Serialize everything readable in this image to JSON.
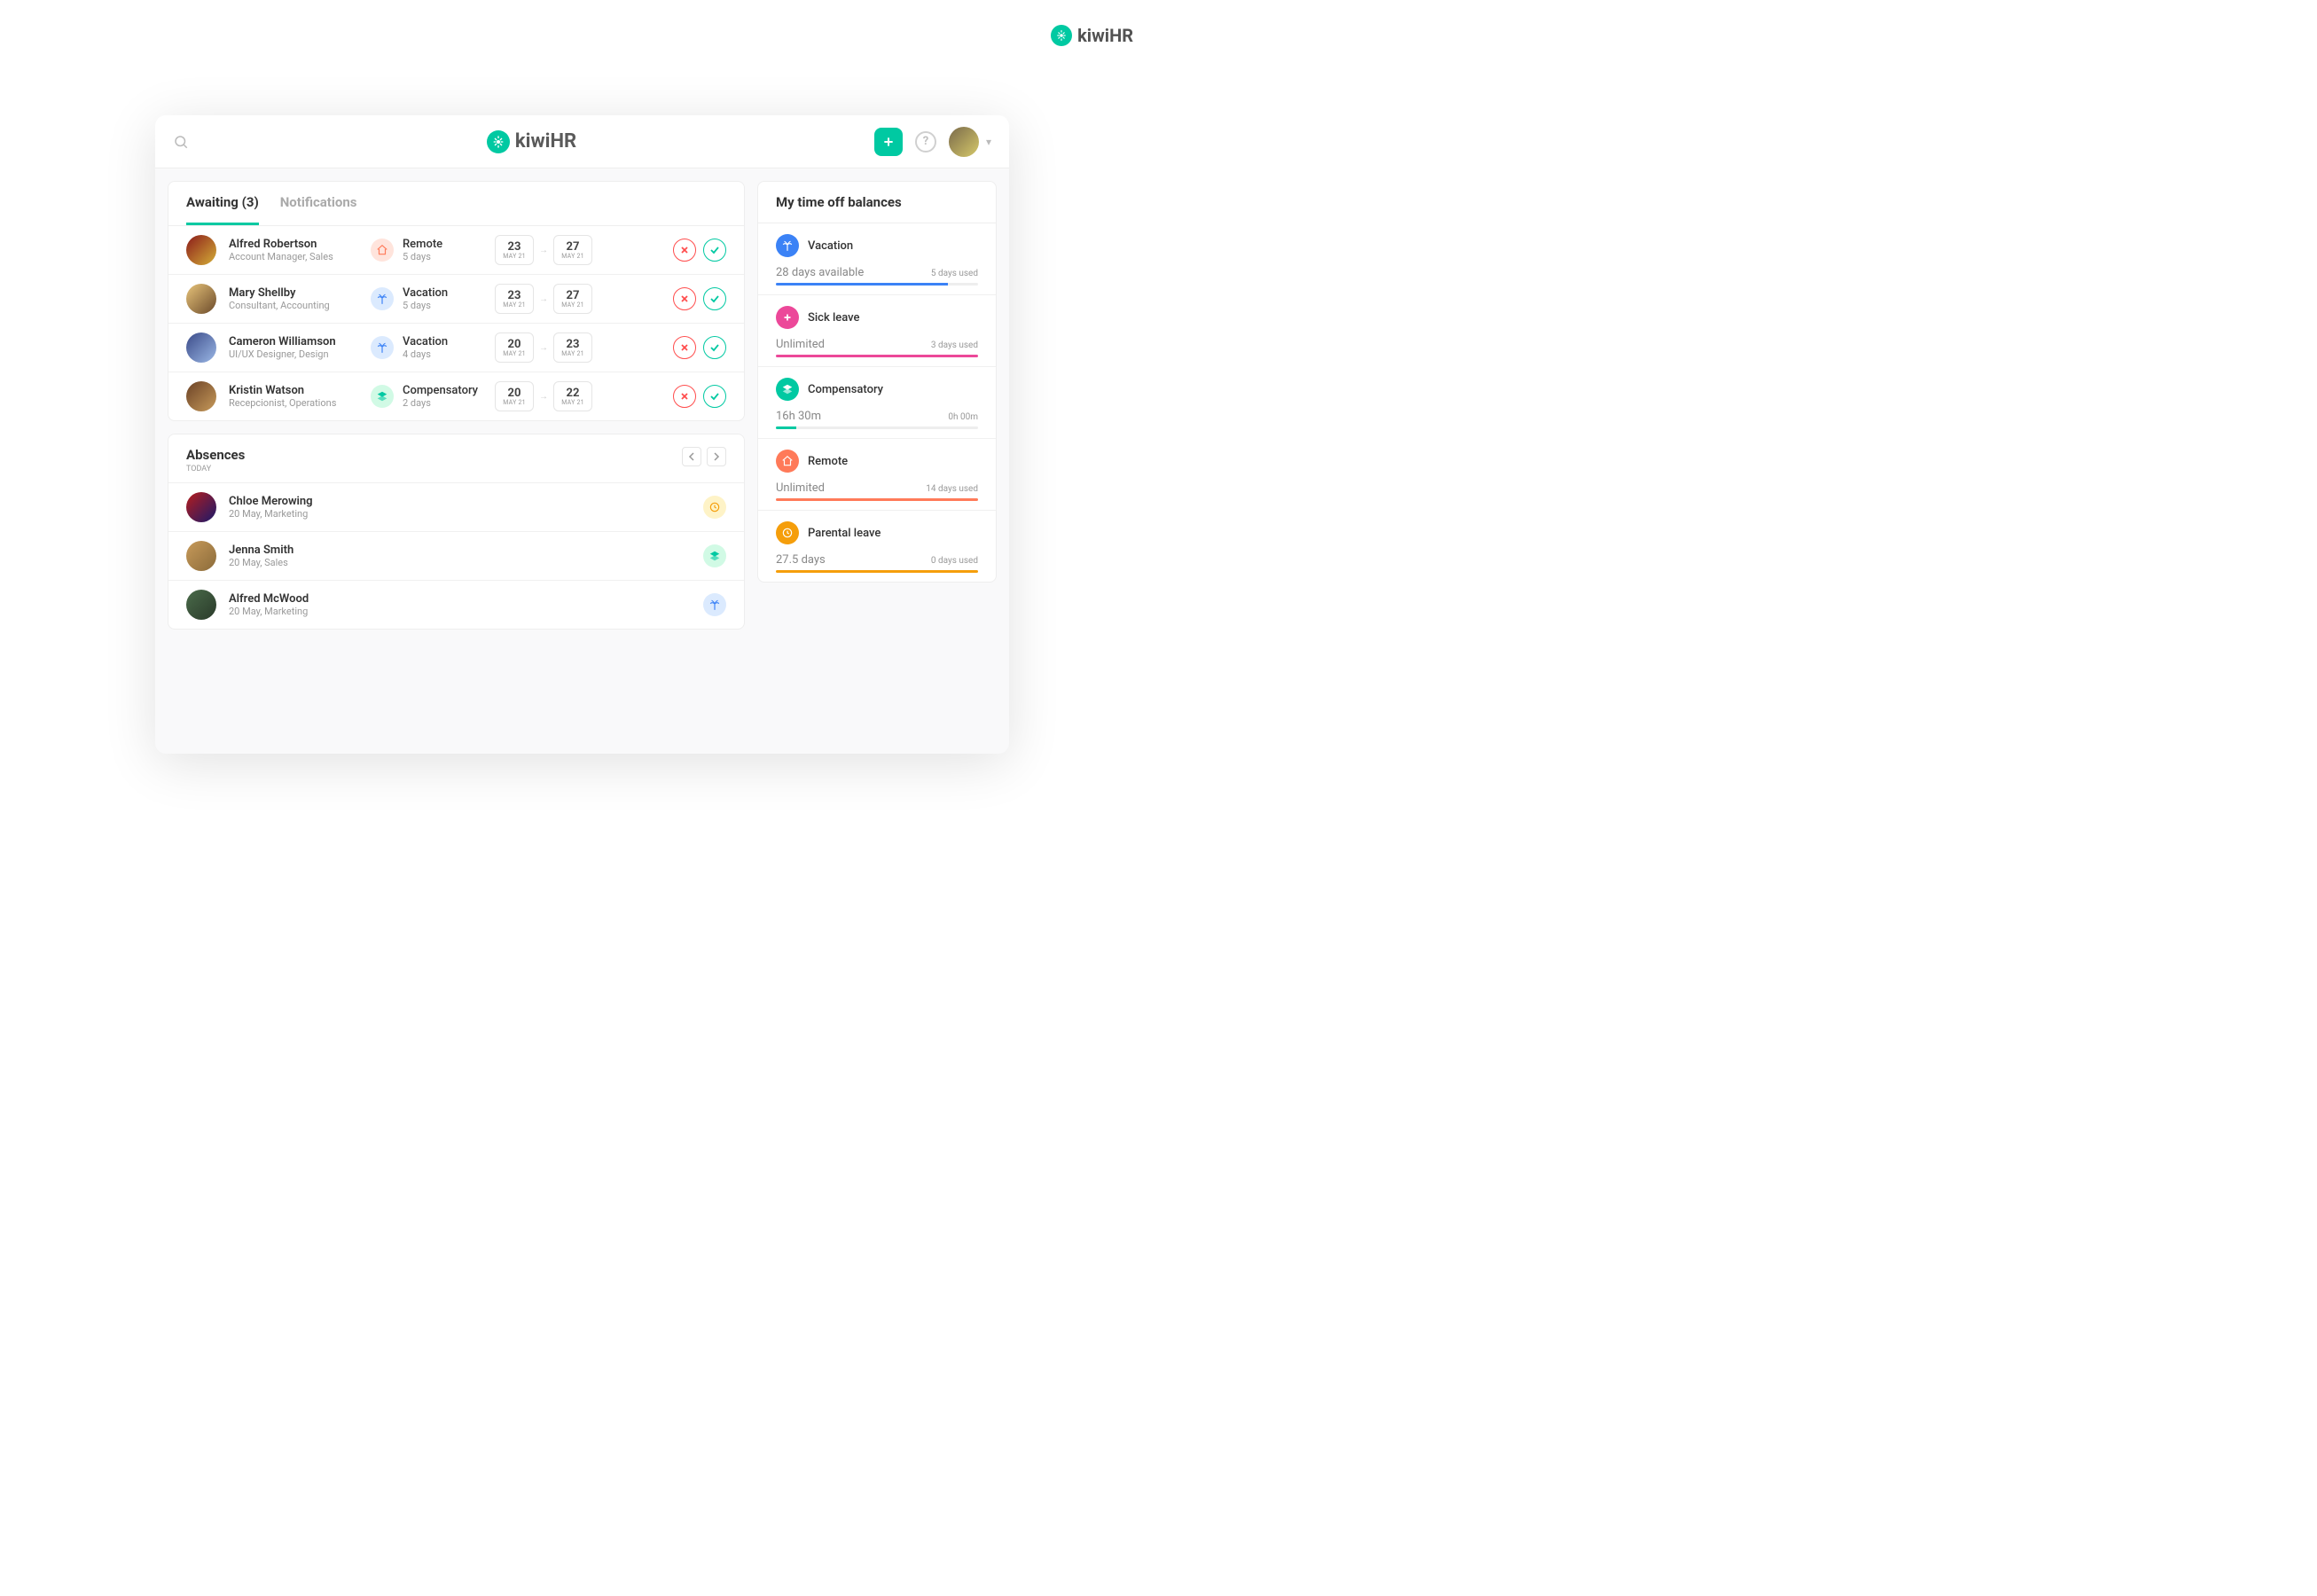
{
  "brand": "kiwiHR",
  "tabs": {
    "awaiting": "Awaiting (3)",
    "notifications": "Notifications"
  },
  "requests": [
    {
      "name": "Alfred Robertson",
      "role": "Account Manager, Sales",
      "type": "Remote",
      "days": "5 days",
      "icon": "home",
      "color": "coral-l",
      "fg": "coral",
      "from_day": "23",
      "from_mon": "MAY 21",
      "to_day": "27",
      "to_mon": "MAY 21",
      "avatar": "linear-gradient(135deg,#8b1a1a,#d4af37)"
    },
    {
      "name": "Mary Shellby",
      "role": "Consultant, Accounting",
      "type": "Vacation",
      "days": "5 days",
      "icon": "palm",
      "color": "blue-l",
      "fg": "blue",
      "from_day": "23",
      "from_mon": "MAY 21",
      "to_day": "27",
      "to_mon": "MAY 21",
      "avatar": "linear-gradient(135deg,#e8c47a,#6b4a2a)"
    },
    {
      "name": "Cameron Williamson",
      "role": "UI/UX Designer, Design",
      "type": "Vacation",
      "days": "4 days",
      "icon": "palm",
      "color": "blue-l",
      "fg": "blue",
      "from_day": "20",
      "from_mon": "MAY 21",
      "to_day": "23",
      "to_mon": "MAY 21",
      "avatar": "linear-gradient(135deg,#3a4a88,#9bb8e6)"
    },
    {
      "name": "Kristin Watson",
      "role": "Recepcionist, Operations",
      "type": "Compensatory",
      "days": "2 days",
      "icon": "layers",
      "color": "teal-l",
      "fg": "teal",
      "from_day": "20",
      "from_mon": "MAY 21",
      "to_day": "22",
      "to_mon": "MAY 21",
      "avatar": "linear-gradient(135deg,#6b4226,#c79a5a)"
    }
  ],
  "absences": {
    "title": "Absences",
    "sub": "TODAY",
    "items": [
      {
        "name": "Chloe Merowing",
        "detail": "20 May, Marketing",
        "badge": "clock",
        "bc": "amber-l",
        "bf": "amber",
        "avatar": "linear-gradient(135deg,#b71c1c,#1a1a6b)"
      },
      {
        "name": "Jenna Smith",
        "detail": "20 May, Sales",
        "badge": "layers",
        "bc": "teal-l",
        "bf": "teal",
        "avatar": "linear-gradient(135deg,#c79a5a,#8b6b3a)"
      },
      {
        "name": "Alfred McWood",
        "detail": "20 May, Marketing",
        "badge": "palm",
        "bc": "blue-l",
        "bf": "blue",
        "avatar": "linear-gradient(135deg,#4a6b4a,#2a3a2a)"
      }
    ]
  },
  "balances": {
    "title": "My time off balances",
    "items": [
      {
        "name": "Vacation",
        "icon": "palm",
        "color": "blue",
        "avail": "28 days available",
        "used": "5 days used",
        "pct": 85
      },
      {
        "name": "Sick leave",
        "icon": "plus",
        "color": "pink",
        "avail": "Unlimited",
        "used": "3 days used",
        "pct": 100
      },
      {
        "name": "Compensatory",
        "icon": "layers",
        "color": "teal",
        "avail": "16h 30m",
        "used": "0h 00m",
        "pct": 10
      },
      {
        "name": "Remote",
        "icon": "home",
        "color": "coral",
        "avail": "Unlimited",
        "used": "14 days used",
        "pct": 100
      },
      {
        "name": "Parental leave",
        "icon": "clock",
        "color": "amber",
        "avail": "27.5 days",
        "used": "0 days used",
        "pct": 100
      }
    ]
  }
}
